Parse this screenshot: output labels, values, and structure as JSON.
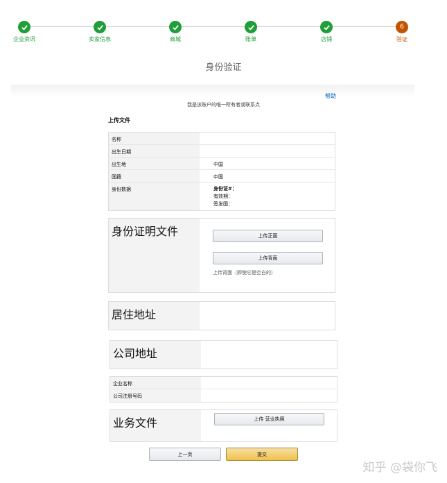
{
  "progress": {
    "steps": [
      {
        "label": "企业资讯",
        "state": "done"
      },
      {
        "label": "卖家信息",
        "state": "done"
      },
      {
        "label": "商城",
        "state": "done"
      },
      {
        "label": "账单",
        "state": "done"
      },
      {
        "label": "店铺",
        "state": "done"
      },
      {
        "label": "验证",
        "state": "current",
        "number": "6"
      }
    ],
    "colors": {
      "done": "#1f9e3a",
      "current": "#c45500"
    }
  },
  "page": {
    "title": "身份验证",
    "help_link": "帮助",
    "subtitle": "我是该账户的唯一所有者或联系点",
    "upload_section_title": "上传文件"
  },
  "identity": {
    "rows": [
      {
        "label": "名称",
        "value": ""
      },
      {
        "label": "出生日期",
        "value": ""
      },
      {
        "label": "出生地",
        "value": "中国"
      },
      {
        "label": "国籍",
        "value": "中国"
      }
    ],
    "id_data": {
      "label": "身份数据",
      "line1": "身份证#：",
      "line2": "有效期：",
      "line3": "签发国："
    }
  },
  "id_docs": {
    "label": "身份证明文件",
    "upload_front": "上传正面",
    "upload_back": "上传背面",
    "back_note": "上传背面（即使它是空白的）"
  },
  "residence": {
    "label": "居住地址"
  },
  "company_address": {
    "label": "公司地址"
  },
  "company": {
    "name_label": "企业名称",
    "reg_label": "公司注册号码"
  },
  "business_docs": {
    "label": "业务文件",
    "upload_license": "上传 营业执照"
  },
  "footer": {
    "prev_button": "上一页",
    "submit_button": "提交"
  },
  "watermark": "知乎 @袋你飞"
}
